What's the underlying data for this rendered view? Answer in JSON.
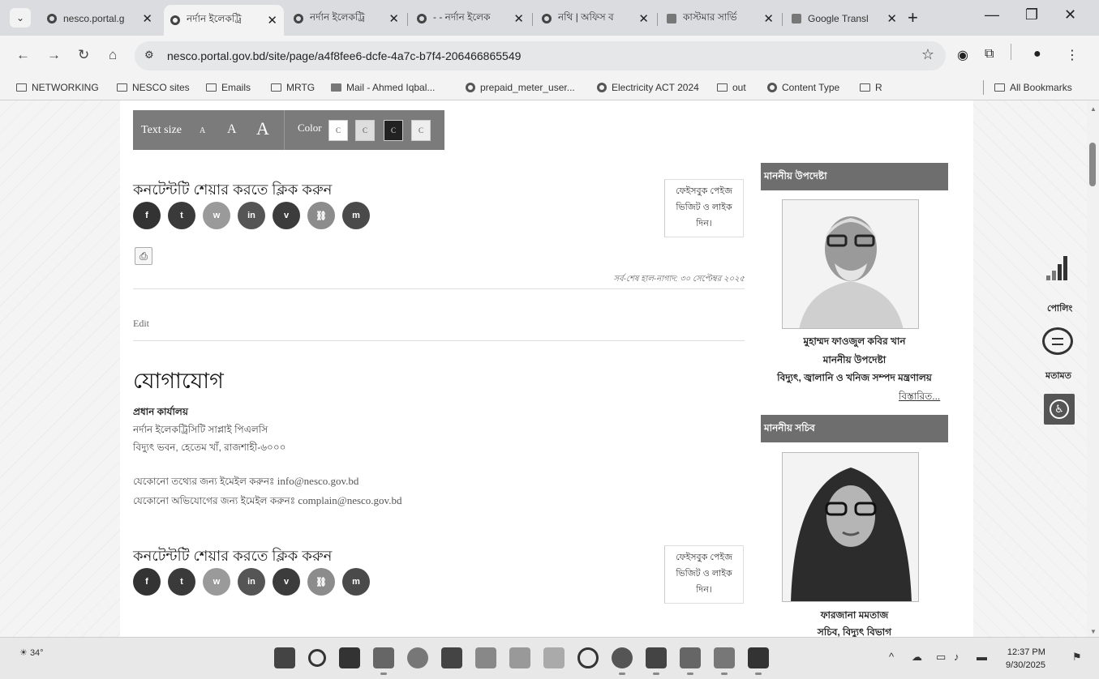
{
  "browser": {
    "tabs": [
      {
        "title": "nesco.portal.g",
        "active": false
      },
      {
        "title": "নর্দান ইলেকট্রি",
        "active": true
      },
      {
        "title": "নর্দান ইলেকট্রি",
        "active": false
      },
      {
        "title": "- - নর্দান ইলেক",
        "active": false
      },
      {
        "title": "নথি | অফিস ব",
        "active": false
      },
      {
        "title": "কাস্টমার সার্ভি",
        "active": false
      },
      {
        "title": "Google Transl",
        "active": false
      }
    ],
    "tab_close_glyph": "✕",
    "new_tab_glyph": "+",
    "tab_menu_glyph": "⌄",
    "url": "nesco.portal.gov.bd/site/page/a4f8fee6-dcfe-4a7c-b7f4-206466865549",
    "bookmarks": [
      {
        "label": "NETWORKING",
        "icon": "folder-icon"
      },
      {
        "label": "NESCO sites",
        "icon": "folder-icon"
      },
      {
        "label": "Emails",
        "icon": "folder-icon"
      },
      {
        "label": "MRTG",
        "icon": "folder-icon"
      },
      {
        "label": "Mail - Ahmed Iqbal...",
        "icon": "mail-icon"
      },
      {
        "label": "prepaid_meter_user...",
        "icon": "globe-icon"
      },
      {
        "label": "Electricity ACT 2024",
        "icon": "site-icon"
      },
      {
        "label": "out",
        "icon": "folder-icon"
      },
      {
        "label": "Content Type",
        "icon": "site-icon"
      },
      {
        "label": "R",
        "icon": "folder-icon"
      }
    ],
    "all_bookmarks": "All Bookmarks"
  },
  "a11y_bar": {
    "text_size_label": "Text size",
    "size_small": "A",
    "size_medium": "A",
    "size_large": "A",
    "color_label": "Color",
    "color_options": [
      "C",
      "C",
      "C",
      "C"
    ],
    "bg_color": "#7b7b7b"
  },
  "share": {
    "heading": "কনটেন্টটি শেয়ার করতে ক্লিক করুন",
    "buttons": [
      {
        "icon": "facebook-icon",
        "glyph": "f",
        "color": "#333333"
      },
      {
        "icon": "twitter-icon",
        "glyph": "t",
        "color": "#3a3a3a"
      },
      {
        "icon": "whatsapp-icon",
        "glyph": "w",
        "color": "#9a9a9a"
      },
      {
        "icon": "linkedin-icon",
        "glyph": "in",
        "color": "#555555"
      },
      {
        "icon": "viber-icon",
        "glyph": "v",
        "color": "#3c3c3c"
      },
      {
        "icon": "link-icon",
        "glyph": "⛓",
        "color": "#8c8c8c"
      },
      {
        "icon": "messenger-icon",
        "glyph": "m",
        "color": "#4a4a4a"
      }
    ],
    "fb_box": [
      "ফেইসবুক পেইজ",
      "ভিজিট ও লাইক",
      "দিন।"
    ]
  },
  "content": {
    "last_updated": "সর্ব-শেষ হাল-নাগাদ: ৩০ সেপ্টেম্বর ২০২৫",
    "edit_link": "Edit",
    "contact_heading": "যোগাযোগ",
    "office_heading": "প্রধান কার্যালয়",
    "office_name": "নর্দান ইলেকট্রিসিটি সাপ্লাই পিএলসি",
    "office_address": "বিদ্যুৎ ভবন, হেতেম খাঁ, রাজশাহী-৬০০০",
    "info_prefix": "যেকোনো তথ্যের জন্য ইমেইল করুনঃ",
    "info_email": "info@nesco.gov.bd",
    "complain_prefix": "যেকোনো অভিযোগের জন্য ইমেইল করুনঃ",
    "complain_email": "complain@nesco.gov.bd"
  },
  "sidebar": {
    "adviser_heading": "মাননীয় উপদেষ্টা",
    "adviser_name": "মুহাম্মদ ফাওজুল কবির খান",
    "adviser_title": "মাননীয় উপদেষ্টা",
    "adviser_ministry": "বিদ্যুৎ, জ্বালানি ও খনিজ সম্পদ মন্ত্রণালয়",
    "details_link": "বিস্তারিত...",
    "secretary_heading": "মাননীয় সচিব",
    "secretary_name": "ফারজানা মমতাজ",
    "secretary_title": "সচিব, বিদ্যুৎ বিভাগ",
    "header_color": "#6e6e6e"
  },
  "widgets": {
    "poll_label": "পোলিং",
    "feedback_label": "মতামত",
    "accessibility_glyph": "♿"
  },
  "taskbar": {
    "temperature": "34°",
    "time": "12:37 PM",
    "date": "9/30/2025",
    "apps": [
      "windows-start-icon",
      "search-icon",
      "task-view-icon",
      "file-explorer-icon",
      "chrome-icon",
      "store-icon",
      "app-icon",
      "app-icon",
      "app-icon",
      "whatsapp-icon",
      "chrome-icon",
      "outlook-icon",
      "calculator-icon",
      "notepad-icon",
      "remote-icon"
    ]
  }
}
